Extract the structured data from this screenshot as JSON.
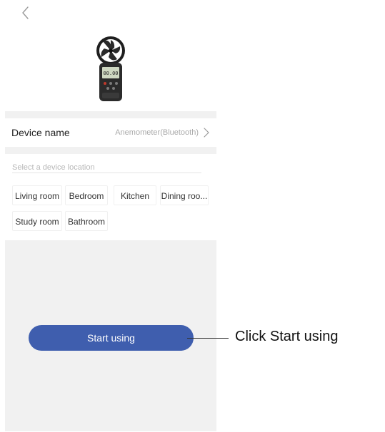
{
  "header": {
    "back_icon": "chevron-left-icon"
  },
  "device": {
    "image_icon": "anemometer-device-icon",
    "screen_reading": "00.00"
  },
  "device_name_row": {
    "label": "Device name",
    "value": "Anemometer(Bluetooth)",
    "chevron_icon": "chevron-right-icon"
  },
  "location": {
    "placeholder": "Select a device location",
    "rooms": [
      "Living room",
      "Bedroom",
      "Kitchen",
      "Dining roo...",
      "Study room",
      "Bathroom"
    ]
  },
  "actions": {
    "start_label": "Start using"
  },
  "annotation": {
    "callout_text": "Click Start using"
  },
  "colors": {
    "accent": "#3f5eae",
    "band_background": "#f1f1f1",
    "muted_text": "#aaaaaa"
  }
}
